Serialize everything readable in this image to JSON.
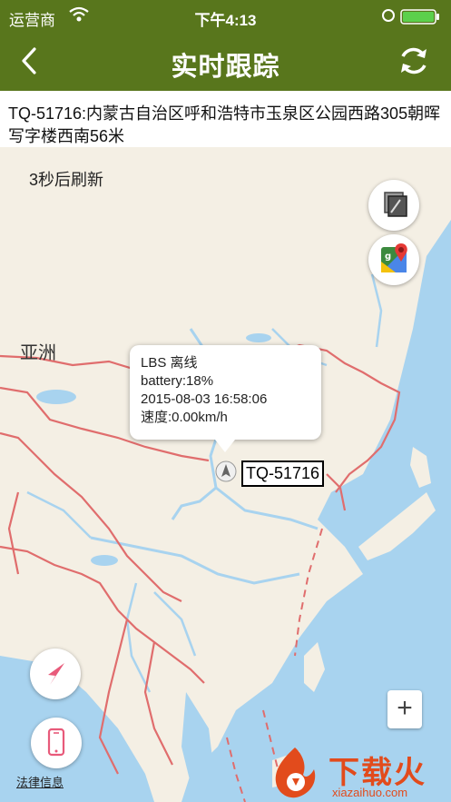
{
  "status_bar": {
    "carrier": "运营商",
    "time": "下午4:13"
  },
  "nav": {
    "title": "实时跟踪"
  },
  "address": {
    "text": "TQ-51716:内蒙古自治区呼和浩特市玉泉区公园西路305朝晖写字楼西南56米"
  },
  "map": {
    "countdown": "3秒后刷新",
    "region_label": "亚洲",
    "popup": {
      "line1": "LBS 离线",
      "line2": "battery:18%",
      "line3": "2015-08-03 16:58:06",
      "line4": "速度:0.00km/h"
    },
    "device_label": "TQ-51716",
    "legal": "法律信息",
    "zoom_in": "+"
  },
  "watermark": {
    "text": "下载火",
    "url": "xiazaihuo.com"
  },
  "colors": {
    "accent": "#58761c",
    "water": "#a8d3ef",
    "border": "#e06d6d"
  }
}
